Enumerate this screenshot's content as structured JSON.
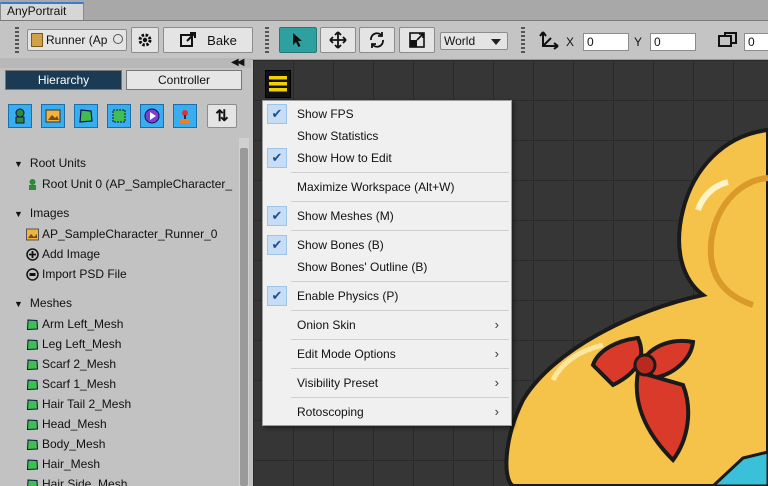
{
  "window": {
    "title": "AnyPortrait"
  },
  "toolbar": {
    "portrait_field": "Runner (Ap",
    "bake_label": "Bake",
    "space_select": "World",
    "x_label": "X",
    "x_value": "0",
    "y_label": "Y",
    "y_value": "0",
    "extra_value": "0"
  },
  "left_tabs": {
    "hierarchy": "Hierarchy",
    "controller": "Controller"
  },
  "tree": {
    "root_units_header": "Root Units",
    "root_units": [
      "Root Unit 0 (AP_SampleCharacter_"
    ],
    "images_header": "Images",
    "images": [
      "AP_SampleCharacter_Runner_0",
      "Add Image",
      "Import PSD File"
    ],
    "meshes_header": "Meshes",
    "meshes": [
      "Arm Left_Mesh",
      "Leg Left_Mesh",
      "Scarf 2_Mesh",
      "Scarf 1_Mesh",
      "Hair Tail 2_Mesh",
      "Head_Mesh",
      "Body_Mesh",
      "Hair_Mesh",
      "Hair Side_Mesh"
    ]
  },
  "menu": {
    "items": [
      {
        "label": "Show FPS",
        "checked": true
      },
      {
        "label": "Show Statistics",
        "checked": false
      },
      {
        "label": "Show How to Edit",
        "checked": true
      },
      {
        "label": "Maximize Workspace (Alt+W)",
        "checked": false
      },
      {
        "label": "Show Meshes (M)",
        "checked": true
      },
      {
        "label": "Show Bones (B)",
        "checked": true
      },
      {
        "label": "Show Bones' Outline (B)",
        "checked": false
      },
      {
        "label": "Enable Physics (P)",
        "checked": true
      },
      {
        "label": "Onion Skin",
        "submenu": true
      },
      {
        "label": "Edit Mode Options",
        "submenu": true
      },
      {
        "label": "Visibility Preset",
        "submenu": true
      },
      {
        "label": "Rotoscoping",
        "submenu": true
      }
    ]
  },
  "colors": {
    "accent_tab": "#1b3b55",
    "icon_blue": "#38aef0",
    "active_tool": "#2fa0a0",
    "menu_highlight": "#f5d000"
  }
}
